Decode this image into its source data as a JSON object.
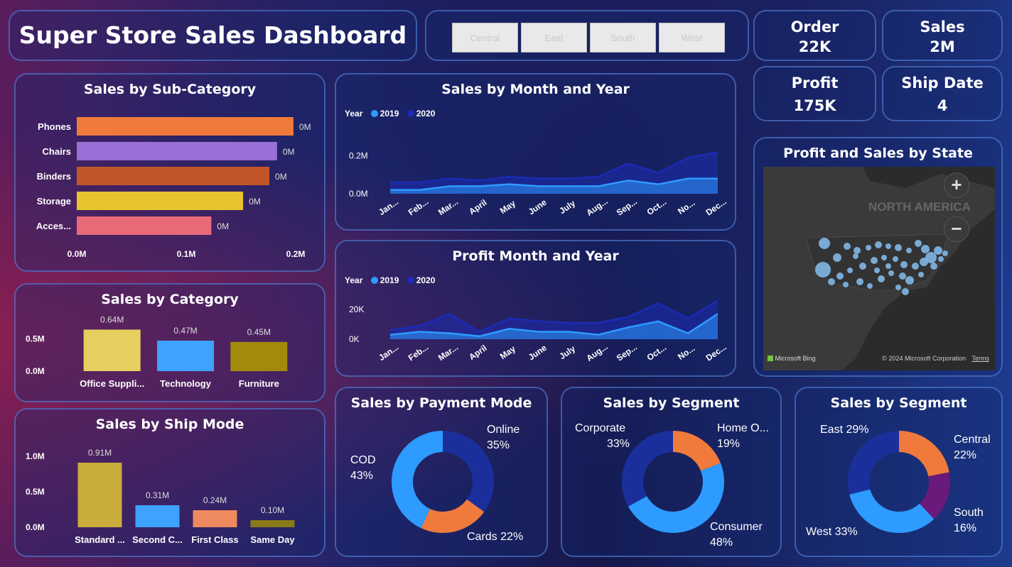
{
  "title": "Super Store Sales Dashboard",
  "slicers": [
    "Central",
    "East",
    "South",
    "West"
  ],
  "kpis": {
    "order": {
      "label": "Order",
      "value": "22K"
    },
    "sales": {
      "label": "Sales",
      "value": "2M"
    },
    "profit": {
      "label": "Profit",
      "value": "175K"
    },
    "ship": {
      "label": "Ship Date",
      "value": "4"
    }
  },
  "subcategory": {
    "title": "Sales by Sub-Category",
    "chart_data": {
      "type": "bar",
      "orientation": "horizontal",
      "categories": [
        "Phones",
        "Chairs",
        "Binders",
        "Storage",
        "Acces..."
      ],
      "values": [
        0.198,
        0.183,
        0.176,
        0.152,
        0.123
      ],
      "data_labels": [
        "0M",
        "0M",
        "0M",
        "0M",
        "0M"
      ],
      "colors": [
        "#f07a3c",
        "#9a6fd6",
        "#c2562a",
        "#e8c52e",
        "#e86a78"
      ],
      "xlim": [
        0,
        0.2
      ],
      "xticks": [
        "0.0M",
        "0.1M",
        "0.2M"
      ],
      "grid": false
    }
  },
  "category": {
    "title": "Sales by Category",
    "chart_data": {
      "type": "bar",
      "categories": [
        "Office Suppli...",
        "Technology",
        "Furniture"
      ],
      "values": [
        0.64,
        0.47,
        0.45
      ],
      "data_labels": [
        "0.64M",
        "0.47M",
        "0.45M"
      ],
      "colors": [
        "#e8d060",
        "#3ea3ff",
        "#a38a0a"
      ],
      "ylim": [
        0,
        0.7
      ],
      "yticks": [
        "0.0M",
        "0.5M"
      ]
    }
  },
  "shipmode": {
    "title": "Sales by Ship Mode",
    "chart_data": {
      "type": "bar",
      "categories": [
        "Standard ...",
        "Second C...",
        "First Class",
        "Same Day"
      ],
      "values": [
        0.91,
        0.31,
        0.24,
        0.1
      ],
      "data_labels": [
        "0.91M",
        "0.31M",
        "0.24M",
        "0.10M"
      ],
      "colors": [
        "#c9ac3a",
        "#3ea3ff",
        "#ef8a5e",
        "#8a7a18"
      ],
      "ylim": [
        0,
        1.1
      ],
      "yticks": [
        "0.0M",
        "0.5M",
        "1.0M"
      ]
    }
  },
  "month_sales": {
    "title": "Sales by Month and Year",
    "legend_title": "Year",
    "chart_data": {
      "type": "area",
      "x": [
        "Jan...",
        "Feb...",
        "Mar...",
        "April",
        "May",
        "June",
        "July",
        "Aug...",
        "Sep...",
        "Oct...",
        "No...",
        "Dec..."
      ],
      "series": [
        {
          "name": "2019",
          "color": "#2d9bff",
          "values": [
            0.02,
            0.02,
            0.04,
            0.04,
            0.05,
            0.04,
            0.04,
            0.04,
            0.07,
            0.05,
            0.08,
            0.08
          ]
        },
        {
          "name": "2020",
          "color": "#1b2bb5",
          "values": [
            0.06,
            0.06,
            0.08,
            0.07,
            0.09,
            0.08,
            0.08,
            0.09,
            0.16,
            0.11,
            0.19,
            0.22
          ]
        }
      ],
      "yticks": [
        "0.0M",
        "0.2M"
      ],
      "ylim": [
        0,
        0.3
      ]
    }
  },
  "month_profit": {
    "title": "Profit Month and Year",
    "legend_title": "Year",
    "chart_data": {
      "type": "area",
      "x": [
        "Jan...",
        "Feb...",
        "Mar...",
        "April",
        "May",
        "June",
        "July",
        "Aug...",
        "Sep...",
        "Oct...",
        "No...",
        "Dec..."
      ],
      "series": [
        {
          "name": "2019",
          "color": "#2d9bff",
          "values": [
            3000,
            5000,
            4000,
            2000,
            7000,
            5000,
            5000,
            3000,
            8000,
            12000,
            4000,
            17000
          ]
        },
        {
          "name": "2020",
          "color": "#1b2bb5",
          "values": [
            6000,
            9000,
            17000,
            5000,
            14000,
            12000,
            11000,
            11000,
            15000,
            24000,
            14000,
            26000
          ]
        }
      ],
      "yticks": [
        "0K",
        "20K"
      ],
      "ylim": [
        0,
        30000
      ]
    }
  },
  "map": {
    "title": "Profit and Sales by State",
    "continent_label": "NORTH AMERICA",
    "zoom_in": "+",
    "zoom_out": "−",
    "bing": "Microsoft Bing",
    "copyright": "© 2024 Microsoft Corporation",
    "terms": "Terms"
  },
  "payment": {
    "title": "Sales by Payment Mode",
    "chart_data": {
      "type": "pie",
      "labels": [
        "Online",
        "Cards",
        "COD"
      ],
      "values": [
        35,
        22,
        43
      ],
      "colors": [
        "#1b2f9c",
        "#f07a3c",
        "#2d9bff"
      ]
    },
    "labels": [
      {
        "name": "Online",
        "pct": "35%"
      },
      {
        "name": "Cards",
        "pct": "22%"
      },
      {
        "name": "COD",
        "pct": "43%"
      }
    ]
  },
  "segment": {
    "title": "Sales by Segment",
    "chart_data": {
      "type": "pie",
      "labels": [
        "Home O...",
        "Consumer",
        "Corporate"
      ],
      "values": [
        19,
        48,
        33
      ],
      "colors": [
        "#f07a3c",
        "#2d9bff",
        "#1b2f9c"
      ]
    },
    "labels": [
      {
        "name": "Home O...",
        "pct": "19%"
      },
      {
        "name": "Consumer",
        "pct": "48%"
      },
      {
        "name": "Corporate",
        "pct": "33%"
      }
    ]
  },
  "region": {
    "title": "Sales by Segment",
    "chart_data": {
      "type": "pie",
      "labels": [
        "Central",
        "South",
        "West",
        "East"
      ],
      "values": [
        22,
        16,
        33,
        29
      ],
      "colors": [
        "#f07a3c",
        "#6a1a7a",
        "#2d9bff",
        "#1b2f9c"
      ]
    },
    "labels": [
      {
        "name": "Central",
        "pct": "22%"
      },
      {
        "name": "South",
        "pct": "16%"
      },
      {
        "name": "West",
        "pct": "33%"
      },
      {
        "name": "East",
        "pct": "29%"
      }
    ]
  }
}
